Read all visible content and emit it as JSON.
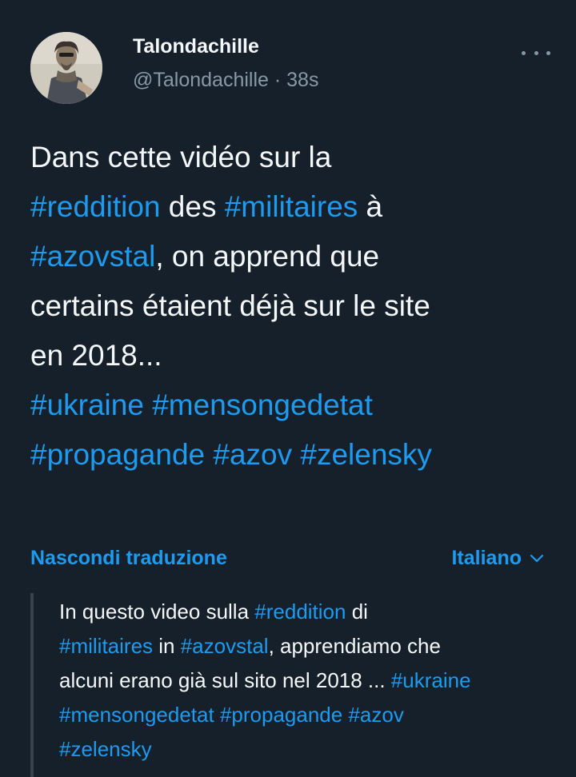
{
  "tweet": {
    "display_name": "Talondachille",
    "handle": "@Talondachille",
    "separator": " · ",
    "time": "38s",
    "body_lines": [
      [
        {
          "text": "Dans cette vidéo sur la",
          "hashtag": false
        }
      ],
      [
        {
          "text": "#reddition",
          "hashtag": true
        },
        {
          "text": " des ",
          "hashtag": false
        },
        {
          "text": "#militaires",
          "hashtag": true
        },
        {
          "text": " à",
          "hashtag": false
        }
      ],
      [
        {
          "text": "#azovstal",
          "hashtag": true
        },
        {
          "text": ", on apprend que",
          "hashtag": false
        }
      ],
      [
        {
          "text": "certains étaient déjà sur le site",
          "hashtag": false
        }
      ],
      [
        {
          "text": "en 2018...",
          "hashtag": false
        }
      ],
      [
        {
          "text": " ",
          "hashtag": false
        }
      ],
      [
        {
          "text": "#ukraine",
          "hashtag": true
        },
        {
          "text": " ",
          "hashtag": false
        },
        {
          "text": "#mensongedetat",
          "hashtag": true
        }
      ],
      [
        {
          "text": "#propagande",
          "hashtag": true
        },
        {
          "text": " ",
          "hashtag": false
        },
        {
          "text": "#azov",
          "hashtag": true
        },
        {
          "text": " ",
          "hashtag": false
        },
        {
          "text": "#zelensky",
          "hashtag": true
        }
      ]
    ]
  },
  "translation": {
    "toggle_label": "Nascondi traduzione",
    "language_label": "Italiano",
    "lines": [
      [
        {
          "text": "In questo video sulla ",
          "hashtag": false
        },
        {
          "text": "#reddition",
          "hashtag": true
        },
        {
          "text": " di",
          "hashtag": false
        }
      ],
      [
        {
          "text": "#militaires",
          "hashtag": true
        },
        {
          "text": " in ",
          "hashtag": false
        },
        {
          "text": "#azovstal",
          "hashtag": true
        },
        {
          "text": ", apprendiamo che",
          "hashtag": false
        }
      ],
      [
        {
          "text": "alcuni erano già sul sito nel 2018 ... ",
          "hashtag": false
        },
        {
          "text": "#ukraine",
          "hashtag": true
        }
      ],
      [
        {
          "text": "#mensongedetat",
          "hashtag": true
        },
        {
          "text": " ",
          "hashtag": false
        },
        {
          "text": "#propagande",
          "hashtag": true
        },
        {
          "text": " ",
          "hashtag": false
        },
        {
          "text": "#azov",
          "hashtag": true
        }
      ],
      [
        {
          "text": "#zelensky",
          "hashtag": true
        }
      ]
    ]
  },
  "icons": {
    "more": "more-horizontal-icon",
    "language_dropdown": "chevron-down-icon"
  },
  "colors": {
    "background": "#15202b",
    "text": "#f5f8fa",
    "secondary": "#8899a6",
    "accent": "#1d9bf0"
  }
}
